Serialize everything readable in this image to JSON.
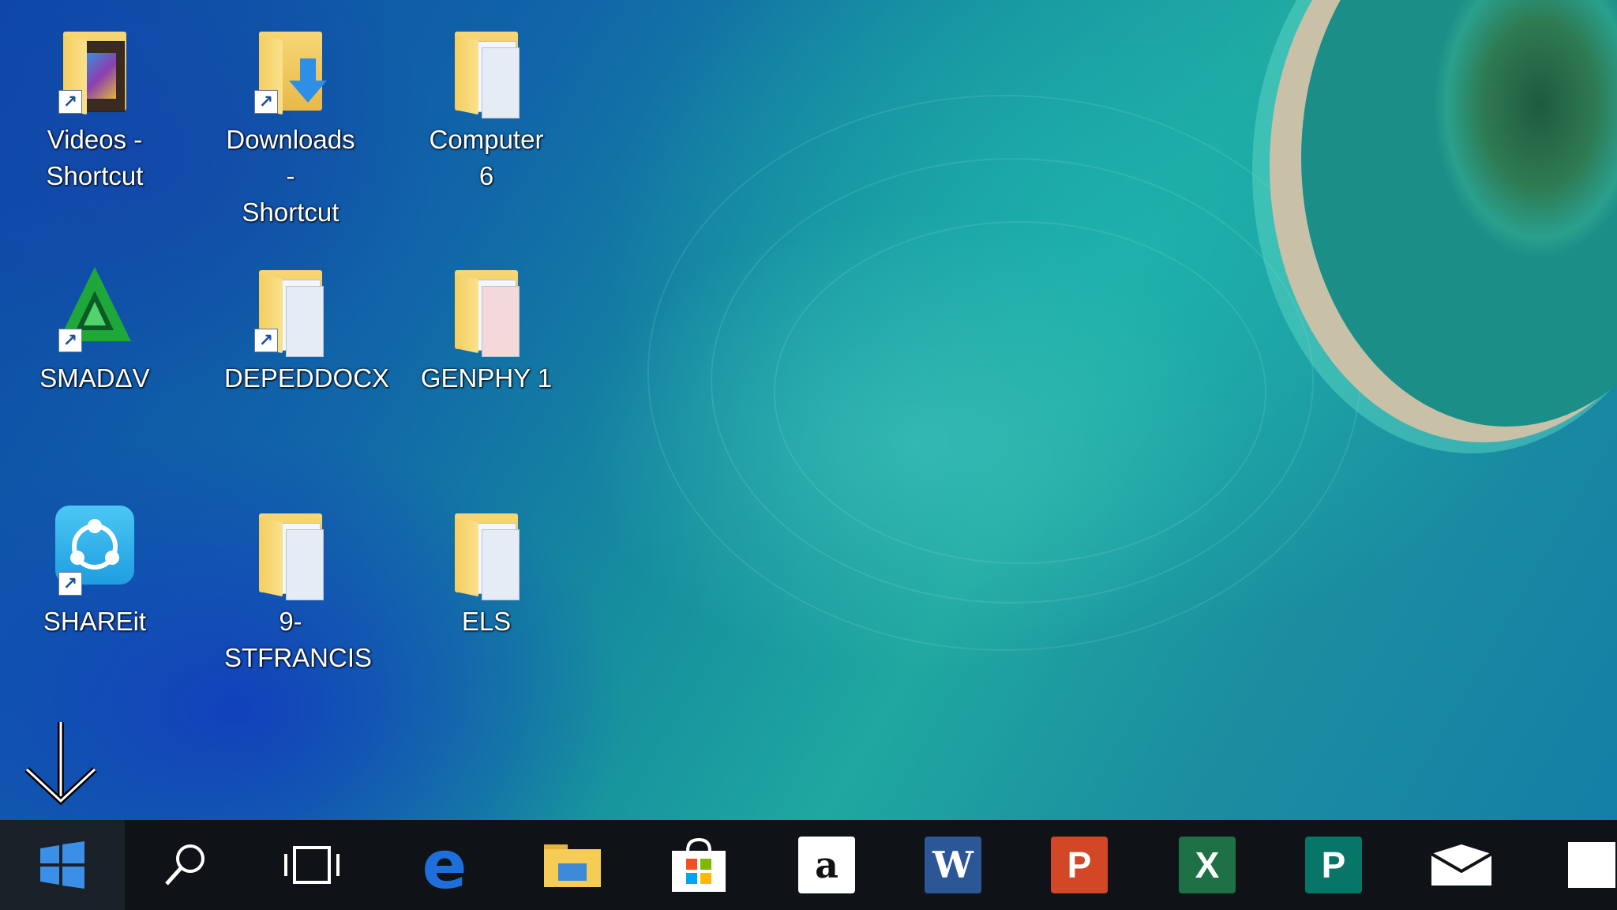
{
  "desktop": {
    "wallpaper": "aerial ocean and island",
    "icons": [
      {
        "label": "Videos -\nShortcut",
        "icon": "video-folder-icon",
        "shortcut": true
      },
      {
        "label": "Downloads -\nShortcut",
        "icon": "downloads-folder-icon",
        "shortcut": true
      },
      {
        "label": "Computer 6",
        "icon": "folder-icon",
        "shortcut": false
      },
      {
        "label": "SMADΔV",
        "icon": "smadav-antivirus-icon",
        "shortcut": true
      },
      {
        "label": "DEPEDDOCX",
        "icon": "folder-icon",
        "shortcut": true
      },
      {
        "label": "GENPHY 1",
        "icon": "folder-icon",
        "shortcut": false
      },
      {
        "label": "SHAREit",
        "icon": "shareit-icon",
        "shortcut": true
      },
      {
        "label": "9-STFRANCIS",
        "icon": "folder-icon",
        "shortcut": false
      },
      {
        "label": "ELS",
        "icon": "folder-icon",
        "shortcut": false
      }
    ],
    "shortcut_arrow": "↗"
  },
  "annotation": {
    "arrow": "down-arrow"
  },
  "taskbar": {
    "items": [
      {
        "name": "start",
        "icon": "windows-logo-icon"
      },
      {
        "name": "search",
        "icon": "search-icon"
      },
      {
        "name": "task-view",
        "icon": "task-view-icon"
      },
      {
        "name": "edge",
        "icon": "edge-icon",
        "glyph": "e"
      },
      {
        "name": "file-explorer",
        "icon": "file-explorer-icon"
      },
      {
        "name": "store",
        "icon": "store-icon"
      },
      {
        "name": "amazon",
        "icon": "amazon-icon",
        "glyph": "a"
      },
      {
        "name": "word",
        "icon": "word-icon",
        "glyph": "W"
      },
      {
        "name": "powerpoint",
        "icon": "powerpoint-icon",
        "glyph": "P"
      },
      {
        "name": "excel",
        "icon": "excel-icon",
        "glyph": "X"
      },
      {
        "name": "publisher",
        "icon": "publisher-icon",
        "glyph": "P"
      },
      {
        "name": "mail",
        "icon": "mail-icon"
      },
      {
        "name": "partial-app",
        "icon": "app-icon"
      }
    ],
    "colors": {
      "word": "#2b5797",
      "powerpoint": "#d24726",
      "excel": "#1e7145",
      "publisher": "#077568",
      "edge": "#1e6fd9",
      "store": "#f25022"
    }
  }
}
